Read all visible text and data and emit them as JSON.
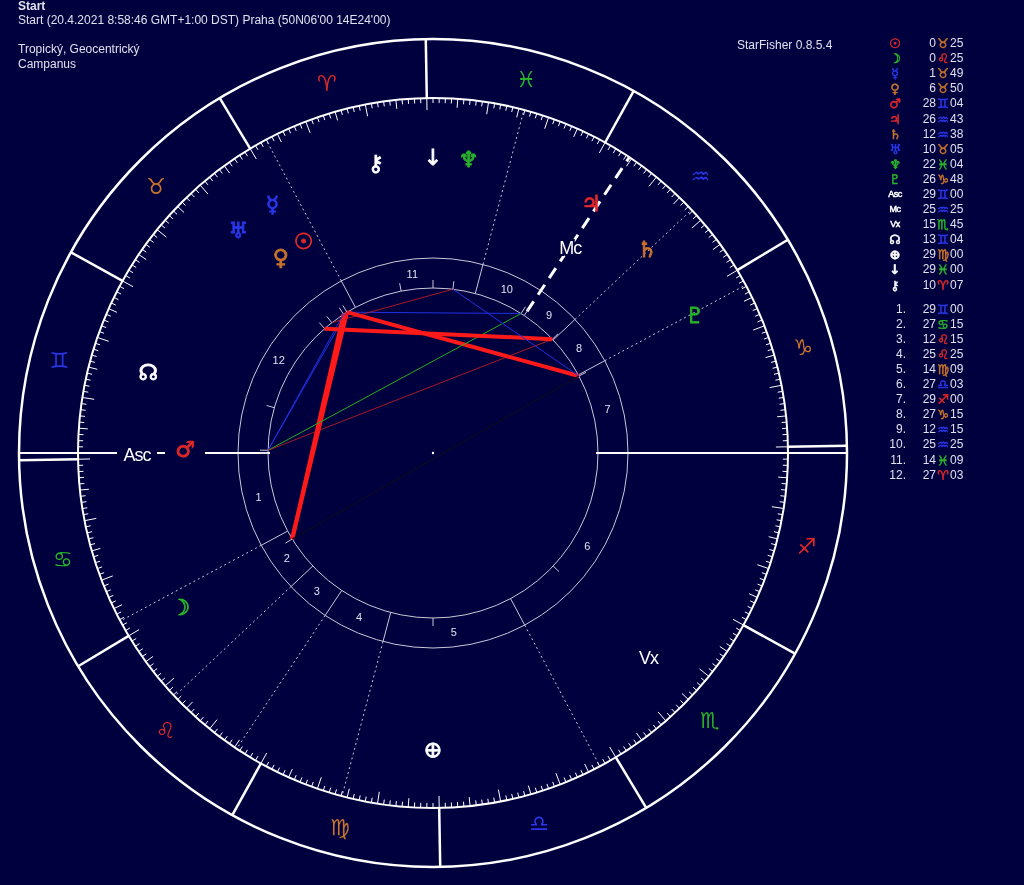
{
  "title": "Start",
  "subtitle": "Start (20.4.2021 8:58:46 GMT+1:00 DST) Praha (50N06'00 14E24'00)",
  "zodiac": "Tropický, Geocentrický",
  "house_system": "Campanus",
  "app_version": "StarFisher 0.8.5.4",
  "positions": [
    {
      "kind": "sun",
      "glyph": "☉",
      "color": "#e02828",
      "degrees": "0",
      "sign": {
        "kind": "taurus",
        "glyph": "♉",
        "color": "#c8742c"
      },
      "minutes": "25"
    },
    {
      "kind": "moon",
      "glyph": "☽",
      "color": "#28b428",
      "degrees": "0",
      "sign": {
        "kind": "leo",
        "glyph": "♌",
        "color": "#e02828"
      },
      "minutes": "25"
    },
    {
      "kind": "mercury",
      "glyph": "☿",
      "color": "#2838e8",
      "degrees": "1",
      "sign": {
        "kind": "taurus",
        "glyph": "♉",
        "color": "#c8742c"
      },
      "minutes": "49"
    },
    {
      "kind": "venus",
      "glyph": "♀",
      "color": "#c8742c",
      "degrees": "6",
      "sign": {
        "kind": "taurus",
        "glyph": "♉",
        "color": "#c8742c"
      },
      "minutes": "50"
    },
    {
      "kind": "mars",
      "glyph": "♂",
      "color": "#e02828",
      "degrees": "28",
      "sign": {
        "kind": "gemini",
        "glyph": "♊",
        "color": "#2838e8"
      },
      "minutes": "04"
    },
    {
      "kind": "jupiter",
      "glyph": "♃",
      "color": "#e02828",
      "degrees": "26",
      "sign": {
        "kind": "aquarius",
        "glyph": "♒",
        "color": "#2838e8"
      },
      "minutes": "43"
    },
    {
      "kind": "saturn",
      "glyph": "♄",
      "color": "#c8742c",
      "degrees": "12",
      "sign": {
        "kind": "aquarius",
        "glyph": "♒",
        "color": "#2838e8"
      },
      "minutes": "38"
    },
    {
      "kind": "uranus",
      "glyph": "♅",
      "color": "#2838e8",
      "degrees": "10",
      "sign": {
        "kind": "taurus",
        "glyph": "♉",
        "color": "#c8742c"
      },
      "minutes": "05"
    },
    {
      "kind": "neptune",
      "glyph": "♆",
      "color": "#28b428",
      "degrees": "22",
      "sign": {
        "kind": "pisces",
        "glyph": "♓",
        "color": "#28b428"
      },
      "minutes": "04"
    },
    {
      "kind": "pluto",
      "glyph": "♇",
      "color": "#28b428",
      "degrees": "26",
      "sign": {
        "kind": "capricorn",
        "glyph": "♑",
        "color": "#c8742c"
      },
      "minutes": "48"
    },
    {
      "kind": "asc",
      "glyph": "Asc",
      "color": "#ffffff",
      "degrees": "29",
      "sign": {
        "kind": "gemini",
        "glyph": "♊",
        "color": "#2838e8"
      },
      "minutes": "00"
    },
    {
      "kind": "mc",
      "glyph": "Mc",
      "color": "#ffffff",
      "degrees": "25",
      "sign": {
        "kind": "aquarius",
        "glyph": "♒",
        "color": "#2838e8"
      },
      "minutes": "25"
    },
    {
      "kind": "vx",
      "glyph": "Vx",
      "color": "#ffffff",
      "degrees": "15",
      "sign": {
        "kind": "scorpio",
        "glyph": "♏",
        "color": "#28b428"
      },
      "minutes": "45"
    },
    {
      "kind": "node",
      "glyph": "☊",
      "color": "#ffffff",
      "degrees": "13",
      "sign": {
        "kind": "gemini",
        "glyph": "♊",
        "color": "#2838e8"
      },
      "minutes": "04"
    },
    {
      "kind": "fortune",
      "glyph": "⊕",
      "color": "#ffffff",
      "degrees": "29",
      "sign": {
        "kind": "virgo",
        "glyph": "♍",
        "color": "#c8742c"
      },
      "minutes": "00"
    },
    {
      "kind": "lilith",
      "glyph": "↓",
      "color": "#ffffff",
      "degrees": "29",
      "sign": {
        "kind": "pisces",
        "glyph": "♓",
        "color": "#28b428"
      },
      "minutes": "00"
    },
    {
      "kind": "chiron",
      "glyph": "⚷",
      "color": "#ffffff",
      "degrees": "10",
      "sign": {
        "kind": "aries",
        "glyph": "♈",
        "color": "#e02828"
      },
      "minutes": "07"
    }
  ],
  "houses": [
    {
      "label": "1.",
      "degrees": "29",
      "sign": {
        "kind": "gemini",
        "glyph": "♊",
        "color": "#2838e8"
      },
      "minutes": "00"
    },
    {
      "label": "2.",
      "degrees": "27",
      "sign": {
        "kind": "cancer",
        "glyph": "♋",
        "color": "#28b428"
      },
      "minutes": "15"
    },
    {
      "label": "3.",
      "degrees": "12",
      "sign": {
        "kind": "leo",
        "glyph": "♌",
        "color": "#e02828"
      },
      "minutes": "15"
    },
    {
      "label": "4.",
      "degrees": "25",
      "sign": {
        "kind": "leo",
        "glyph": "♌",
        "color": "#e02828"
      },
      "minutes": "25"
    },
    {
      "label": "5.",
      "degrees": "14",
      "sign": {
        "kind": "virgo",
        "glyph": "♍",
        "color": "#c8742c"
      },
      "minutes": "09"
    },
    {
      "label": "6.",
      "degrees": "27",
      "sign": {
        "kind": "libra",
        "glyph": "♎",
        "color": "#2838e8"
      },
      "minutes": "03"
    },
    {
      "label": "7.",
      "degrees": "29",
      "sign": {
        "kind": "sagittarius",
        "glyph": "♐",
        "color": "#e02828"
      },
      "minutes": "00"
    },
    {
      "label": "8.",
      "degrees": "27",
      "sign": {
        "kind": "capricorn",
        "glyph": "♑",
        "color": "#c8742c"
      },
      "minutes": "15"
    },
    {
      "label": "9.",
      "degrees": "12",
      "sign": {
        "kind": "aquarius",
        "glyph": "♒",
        "color": "#2838e8"
      },
      "minutes": "15"
    },
    {
      "label": "10.",
      "degrees": "25",
      "sign": {
        "kind": "aquarius",
        "glyph": "♒",
        "color": "#2838e8"
      },
      "minutes": "25"
    },
    {
      "label": "11.",
      "degrees": "14",
      "sign": {
        "kind": "pisces",
        "glyph": "♓",
        "color": "#28b428"
      },
      "minutes": "09"
    },
    {
      "label": "12.",
      "degrees": "27",
      "sign": {
        "kind": "aries",
        "glyph": "♈",
        "color": "#e02828"
      },
      "minutes": "03"
    }
  ],
  "zodiac_signs": [
    {
      "kind": "aries",
      "glyph": "♈",
      "color": "#e02828"
    },
    {
      "kind": "taurus",
      "glyph": "♉",
      "color": "#c8742c"
    },
    {
      "kind": "gemini",
      "glyph": "♊",
      "color": "#2838e8"
    },
    {
      "kind": "cancer",
      "glyph": "♋",
      "color": "#28b428"
    },
    {
      "kind": "leo",
      "glyph": "♌",
      "color": "#e02828"
    },
    {
      "kind": "virgo",
      "glyph": "♍",
      "color": "#c8742c"
    },
    {
      "kind": "libra",
      "glyph": "♎",
      "color": "#2838e8"
    },
    {
      "kind": "scorpio",
      "glyph": "♏",
      "color": "#28b428"
    },
    {
      "kind": "sagittarius",
      "glyph": "♐",
      "color": "#e02828"
    },
    {
      "kind": "capricorn",
      "glyph": "♑",
      "color": "#c8742c"
    },
    {
      "kind": "aquarius",
      "glyph": "♒",
      "color": "#2838e8"
    },
    {
      "kind": "pisces",
      "glyph": "♓",
      "color": "#28b428"
    }
  ],
  "wheel_points": [
    {
      "kind": "chiron",
      "glyph": "⚷",
      "color": "#ffffff"
    },
    {
      "kind": "lilith",
      "glyph": "↓",
      "color": "#ffffff"
    },
    {
      "kind": "neptune",
      "glyph": "♆",
      "color": "#28b428"
    },
    {
      "kind": "jupiter",
      "glyph": "♃",
      "color": "#e02828"
    },
    {
      "kind": "mc",
      "glyph": "Mc",
      "color": "#ffffff"
    },
    {
      "kind": "saturn",
      "glyph": "♄",
      "color": "#c8742c"
    },
    {
      "kind": "pluto",
      "glyph": "♇",
      "color": "#28b428"
    },
    {
      "kind": "vx",
      "glyph": "Vx",
      "color": "#ffffff"
    },
    {
      "kind": "fortune",
      "glyph": "⊕",
      "color": "#ffffff"
    },
    {
      "kind": "moon",
      "glyph": "☽",
      "color": "#28b428"
    },
    {
      "kind": "asc",
      "glyph": "Asc",
      "color": "#ffffff"
    },
    {
      "kind": "mars",
      "glyph": "♂",
      "color": "#e02828"
    },
    {
      "kind": "node",
      "glyph": "☊",
      "color": "#ffffff"
    },
    {
      "kind": "uranus",
      "glyph": "♅",
      "color": "#2838e8"
    },
    {
      "kind": "mercury",
      "glyph": "☿",
      "color": "#2838e8"
    },
    {
      "kind": "venus",
      "glyph": "♀",
      "color": "#c8742c"
    },
    {
      "kind": "sun",
      "glyph": "☉",
      "color": "#e02828"
    }
  ],
  "house_numbers": [
    "1",
    "2",
    "3",
    "4",
    "5",
    "6",
    "7",
    "8",
    "9",
    "10",
    "11",
    "12"
  ]
}
